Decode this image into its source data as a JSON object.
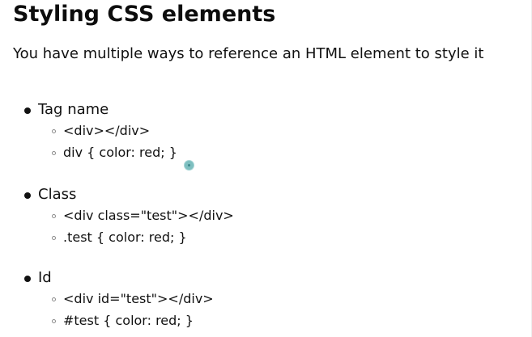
{
  "slide": {
    "title": "Styling CSS elements",
    "subtitle": "You have multiple ways to reference an HTML element to style it"
  },
  "groups": [
    {
      "label": "Tag name",
      "items": [
        "<div></div>",
        "div { color: red; }"
      ]
    },
    {
      "label": "Class",
      "items": [
        "<div class=\"test\"></div>",
        ".test { color: red; }"
      ]
    },
    {
      "label": "Id",
      "items": [
        "<div id=\"test\"></div>",
        "#test { color: red; }"
      ]
    }
  ]
}
